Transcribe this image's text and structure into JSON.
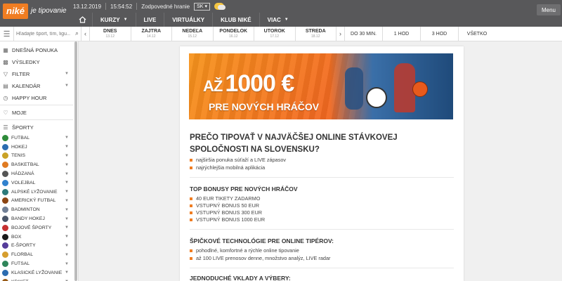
{
  "brand": {
    "logo": "niké",
    "tagline": "je tipovanie"
  },
  "topinfo": {
    "date": "13.12.2019",
    "time": "15:54:52",
    "responsible": "Zodpovedné hranie",
    "lang": "SK"
  },
  "menu_label": "Menu",
  "nav": [
    {
      "label": "KURZY",
      "has_dropdown": true
    },
    {
      "label": "LIVE",
      "has_dropdown": false
    },
    {
      "label": "VIRTUÁLKY",
      "has_dropdown": false
    },
    {
      "label": "KLUB NIKÉ",
      "has_dropdown": false
    },
    {
      "label": "VIAC",
      "has_dropdown": true
    }
  ],
  "search": {
    "placeholder": "Hľadajte šport, tím, ligu..."
  },
  "days": [
    {
      "name": "DNES",
      "date": "13.12"
    },
    {
      "name": "ZAJTRA",
      "date": "14.12"
    },
    {
      "name": "NEDEĽA",
      "date": "15.12"
    },
    {
      "name": "PONDELOK",
      "date": "16.12"
    },
    {
      "name": "UTOROK",
      "date": "17.12"
    },
    {
      "name": "STREDA",
      "date": "18.12"
    }
  ],
  "periods": [
    "DO 30 MIN.",
    "1 HOD",
    "3 HOD",
    "VŠETKO"
  ],
  "sidebar": {
    "main_items": [
      {
        "label": "DNEŠNÁ PONUKA",
        "icon": "calendar-icon",
        "chev": false
      },
      {
        "label": "VÝSLEDKY",
        "icon": "grid-icon",
        "chev": false
      },
      {
        "label": "FILTER",
        "icon": "filter-icon",
        "chev": true
      },
      {
        "label": "KALENDÁR",
        "icon": "calendar-icon",
        "chev": true
      },
      {
        "label": "HAPPY HOUR",
        "icon": "clock-icon",
        "chev": false
      },
      {
        "label": "MOJE",
        "icon": "heart-icon",
        "chev": false
      },
      {
        "label": "ŠPORTY",
        "icon": "list-icon",
        "chev": false
      }
    ],
    "sports": [
      {
        "label": "FUTBAL",
        "color": "#2e8b3a"
      },
      {
        "label": "HOKEJ",
        "color": "#2b6cb0"
      },
      {
        "label": "TENIS",
        "color": "#c9a227"
      },
      {
        "label": "BASKETBAL",
        "color": "#e07b22"
      },
      {
        "label": "HÁDZANÁ",
        "color": "#555555"
      },
      {
        "label": "VOLEJBAL",
        "color": "#3182ce"
      },
      {
        "label": "ALPSKÉ LYŽOVANIE",
        "color": "#2c7a7b"
      },
      {
        "label": "AMERICKÝ FUTBAL",
        "color": "#8b4513"
      },
      {
        "label": "BADMINTON",
        "color": "#718096"
      },
      {
        "label": "BANDY HOKEJ",
        "color": "#4a5568"
      },
      {
        "label": "BOJOVÉ ŠPORTY",
        "color": "#c53030"
      },
      {
        "label": "BOX",
        "color": "#1a1a1a"
      },
      {
        "label": "E-ŠPORTY",
        "color": "#553c9a"
      },
      {
        "label": "FLORBAL",
        "color": "#d69e2e"
      },
      {
        "label": "FUTSAL",
        "color": "#2f855a"
      },
      {
        "label": "KLASICKÉ LYŽOVANIE",
        "color": "#2b6cb0"
      },
      {
        "label": "KRIKET",
        "color": "#975a16"
      }
    ]
  },
  "banner": {
    "line1_prefix": "AŽ",
    "amount": "1000 €",
    "line2": "PRE NOVÝCH HRÁČOV"
  },
  "content": {
    "heading": "PREČO TIPOVAŤ V NAJVÄČŠEJ ONLINE STÁVKOVEJ SPOLOČNOSTI NA SLOVENSKU?",
    "heading_bullets": [
      "najširšia ponuka súťaží a LIVE zápasov",
      "najrýchlejšia mobilná aplikácia"
    ],
    "sections": [
      {
        "title": "TOP BONUSY PRE NOVÝCH HRÁČOV",
        "bullets": [
          "40 EUR TIKETY ZADARMO",
          "VSTUPNÝ BONUS 50 EUR",
          "VSTUPNÝ BONUS 300 EUR",
          "VSTUPNÝ BONUS 1000 EUR"
        ]
      },
      {
        "title": "ŠPIČKOVÉ TECHNOLÓGIE PRE ONLINE TIPÉROV:",
        "bullets": [
          "pohodlné, komfortné a rýchle online tipovanie",
          "až 100 LIVE prenosov denne, množstvo analýz, LIVE radar"
        ]
      },
      {
        "title": "JEDNODUCHÉ VKLADY A VÝBERY:",
        "bullets": []
      }
    ]
  },
  "colors": {
    "brand_orange": "#f07d22",
    "topbar": "#58585a"
  }
}
